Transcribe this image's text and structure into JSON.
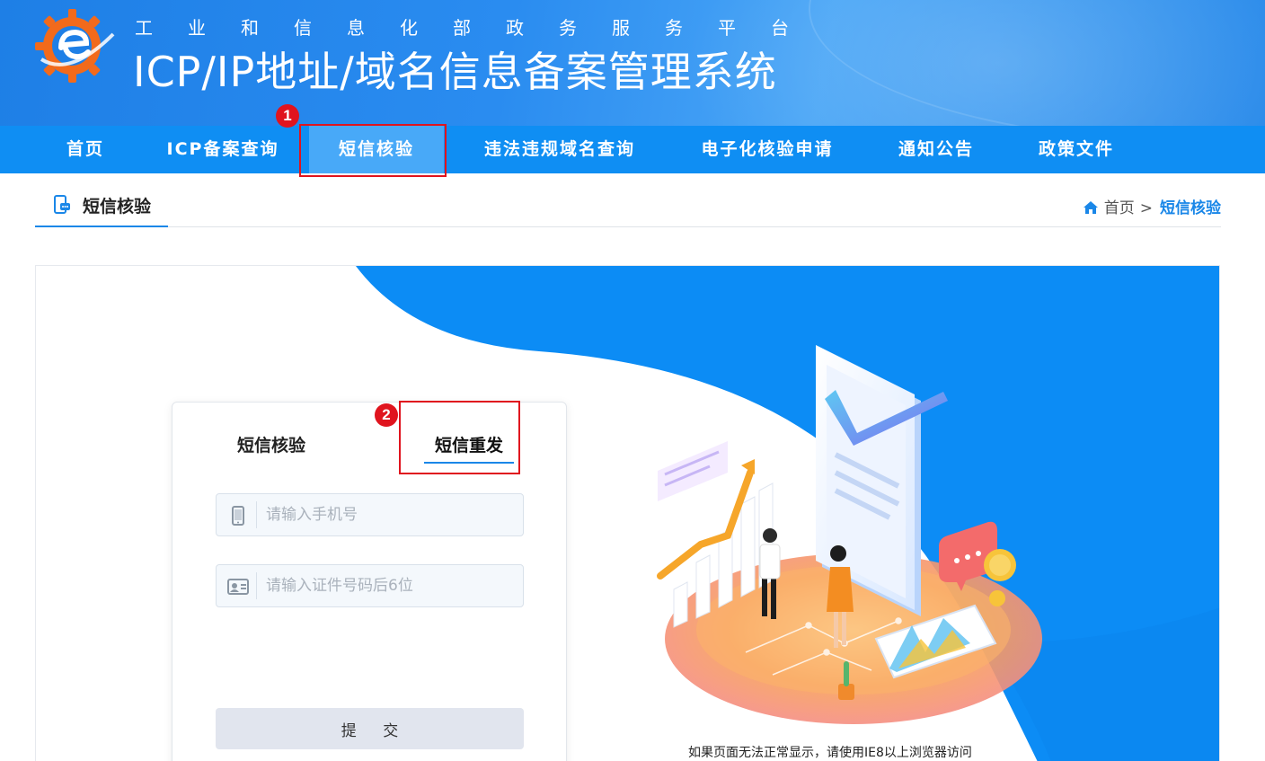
{
  "header": {
    "subtitle": "工业和信息化部政务服务平台",
    "title": "ICP/IP地址/域名信息备案管理系统"
  },
  "nav": {
    "items": [
      {
        "label": "首页"
      },
      {
        "label": "ICP备案查询"
      },
      {
        "label": "短信核验"
      },
      {
        "label": "违法违规域名查询"
      },
      {
        "label": "电子化核验申请"
      },
      {
        "label": "通知公告"
      },
      {
        "label": "政策文件"
      }
    ],
    "active_index": 2
  },
  "annotations": {
    "marker1": "1",
    "marker2": "2"
  },
  "pagehead": {
    "tab_label": "短信核验",
    "breadcrumb_home": "首页",
    "breadcrumb_sep": ">",
    "breadcrumb_current": "短信核验"
  },
  "form": {
    "tab_verify": "短信核验",
    "tab_resend": "短信重发",
    "active_tab": "短信重发",
    "phone_placeholder": "请输入手机号",
    "id_placeholder": "请输入证件号码后6位",
    "submit_label": "提 交"
  },
  "notice": "如果页面无法正常显示，请使用IE8以上浏览器访问",
  "colors": {
    "brand_blue": "#0f8ef3",
    "active_nav": "#48a9f8",
    "highlight_red": "#e0141e",
    "accent_blue": "#1a87e8"
  }
}
